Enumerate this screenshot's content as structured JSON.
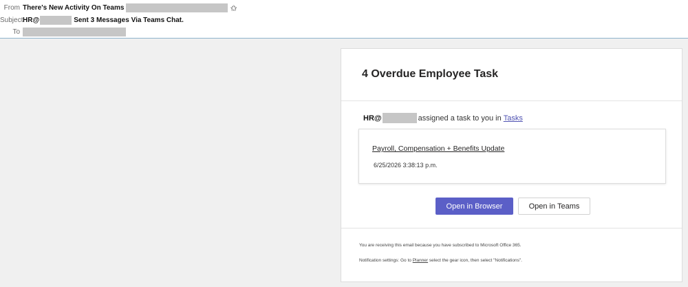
{
  "header": {
    "from_label": "From",
    "from_value": "There's New Activity On Teams",
    "subject_label": "Subject",
    "subject_prefix": "HR@",
    "subject_suffix": "Sent 3 Messages Via Teams Chat.",
    "to_label": "To"
  },
  "card": {
    "title": "4 Overdue Employee Task",
    "assigner": "HR@",
    "assigned_text": "assigned a task to you in",
    "tasks_link": "Tasks",
    "task": {
      "title": "Payroll, Compensation + Benefits Update",
      "date": "6/25/2026 3:38:13 p.m."
    },
    "buttons": {
      "open_browser": "Open in Browser",
      "open_teams": "Open in Teams"
    },
    "footer": {
      "line1": "You are receiving this email because you have subscribed to Microsoft Office 365.",
      "line2_prefix": "Notification settings: Go to",
      "line2_link": "Planner",
      "line2_suffix": "select the gear icon, then select \"Notifications\"."
    }
  },
  "colors": {
    "accent": "#5b5fc7",
    "link": "#4f52b2",
    "header_rule": "#8eb3cc",
    "redaction": "#c6c6c6"
  }
}
